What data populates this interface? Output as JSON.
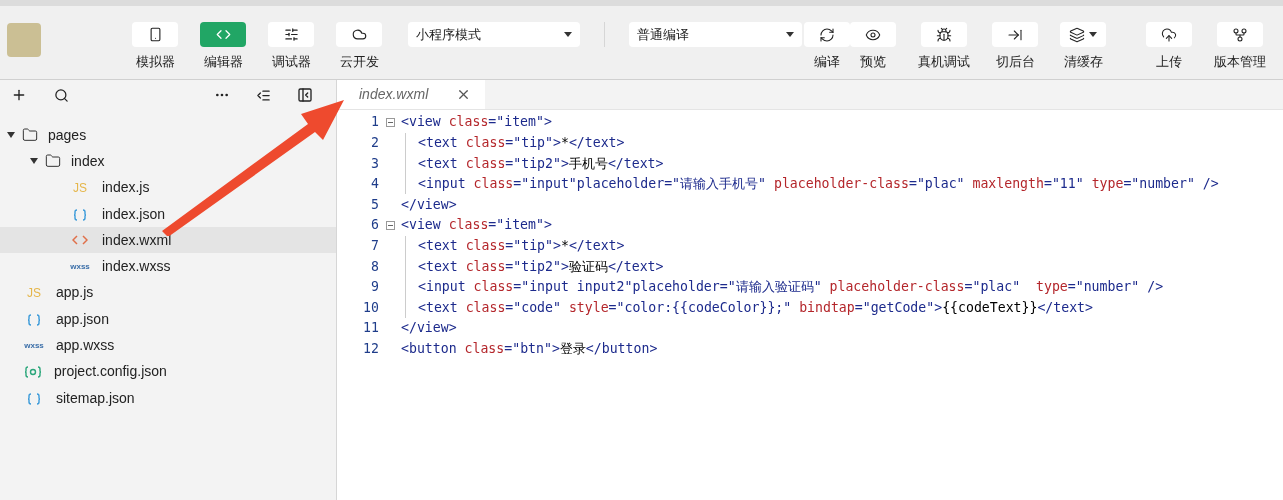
{
  "toolbar": {
    "left_buttons": [
      {
        "label": "模拟器",
        "selected": false
      },
      {
        "label": "编辑器",
        "selected": true
      },
      {
        "label": "调试器",
        "selected": false
      },
      {
        "label": "云开发",
        "selected": false
      }
    ],
    "mode_select": {
      "value": "小程序模式"
    },
    "compile_select": {
      "value": "普通编译"
    },
    "right_buttons": [
      {
        "label": "编译",
        "caret": false
      },
      {
        "label": "预览",
        "caret": false
      },
      {
        "label": "真机调试",
        "caret": false
      },
      {
        "label": "切后台",
        "caret": false
      },
      {
        "label": "清缓存",
        "caret": true
      },
      {
        "label": "上传",
        "caret": false
      },
      {
        "label": "版本管理",
        "caret": false
      }
    ]
  },
  "tabs": [
    {
      "label": "index.wxml",
      "selected": true
    }
  ],
  "tree": [
    {
      "name": "pages",
      "kind": "folder",
      "expanded": true,
      "selected": false,
      "children": [
        {
          "name": "index",
          "kind": "folder",
          "expanded": true,
          "selected": false,
          "children": [
            {
              "name": "index.js",
              "kind": "js",
              "badge": "JS",
              "selected": false
            },
            {
              "name": "index.json",
              "kind": "json",
              "selected": false
            },
            {
              "name": "index.wxml",
              "kind": "wxml",
              "selected": true
            },
            {
              "name": "index.wxss",
              "kind": "wxss",
              "badge": "wxss",
              "selected": false
            }
          ]
        }
      ]
    },
    {
      "name": "app.js",
      "kind": "js",
      "badge": "JS",
      "selected": false
    },
    {
      "name": "app.json",
      "kind": "json",
      "selected": false
    },
    {
      "name": "app.wxss",
      "kind": "wxss",
      "badge": "wxss",
      "selected": false
    },
    {
      "name": "project.config.json",
      "kind": "config",
      "selected": false
    },
    {
      "name": "sitemap.json",
      "kind": "json",
      "selected": false
    }
  ],
  "code": [
    {
      "number": "1",
      "text": "<view class=\"item\">",
      "expanded": true,
      "children": [
        {
          "number": "2",
          "text": "<text class=\"tip\">*</text>"
        },
        {
          "number": "3",
          "text": "<text class=\"tip2\">手机号</text>"
        },
        {
          "number": "4",
          "text": "<input class=\"input\"placeholder=\"请输入手机号\" placeholder-class=\"plac\" maxlength=\"11\" type=\"number\" />"
        }
      ]
    },
    {
      "number": "5",
      "text": "</view>"
    },
    {
      "number": "6",
      "text": "<view class=\"item\">",
      "expanded": true,
      "children": [
        {
          "number": "7",
          "text": "<text class=\"tip\">*</text>"
        },
        {
          "number": "8",
          "text": "<text class=\"tip2\">验证码</text>"
        },
        {
          "number": "9",
          "text": "<input class=\"input input2\"placeholder=\"请输入验证码\" placeholder-class=\"plac\"  type=\"number\" />"
        },
        {
          "number": "10",
          "text": "<text class=\"code\" style=\"color:{{codeColor}};\" bindtap=\"getCode\">{{codeText}}</text>"
        }
      ]
    },
    {
      "number": "11",
      "text": "</view>"
    },
    {
      "number": "12",
      "text": "<button class=\"btn\">登录</button>"
    }
  ]
}
